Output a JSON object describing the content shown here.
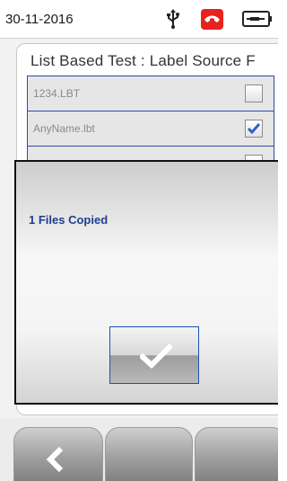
{
  "status_bar": {
    "date": "30-11-2016",
    "icons": [
      "usb-icon",
      "phone-icon",
      "battery-icon"
    ],
    "phone_icon_color": "#e8231d"
  },
  "screen": {
    "title": "List Based Test : Label Source F",
    "files": [
      {
        "name": "1234.LBT",
        "checked": false
      },
      {
        "name": "AnyName.lbt",
        "checked": true
      }
    ]
  },
  "dialog": {
    "message": "1 Files Copied",
    "ok_icon": "checkmark-icon",
    "message_color": "#1f3f8f",
    "border_accent": "#1f4fb5"
  },
  "bottom_bar": {
    "keys": [
      {
        "icon": "back-icon"
      },
      {
        "icon": ""
      },
      {
        "icon": ""
      }
    ]
  }
}
